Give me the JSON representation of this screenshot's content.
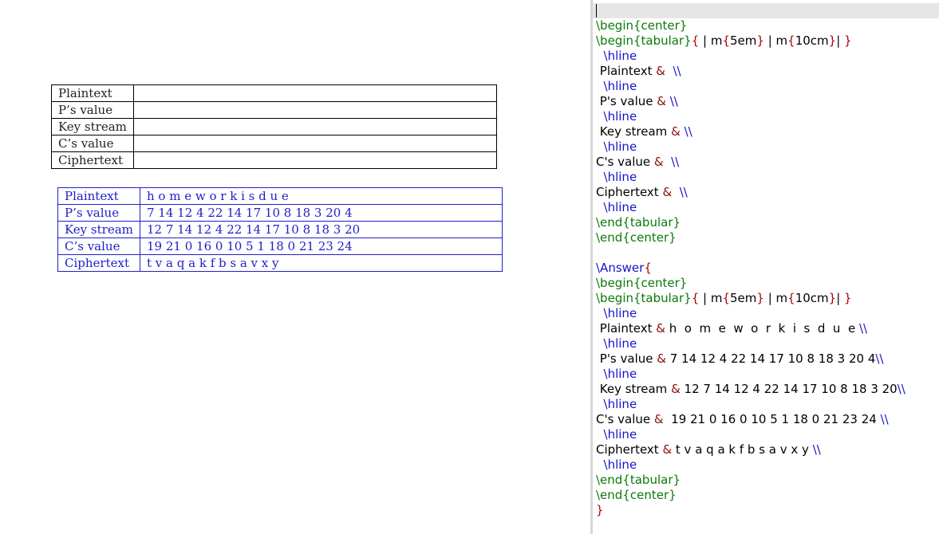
{
  "preview": {
    "question_table": {
      "rows": [
        {
          "label": "Plaintext",
          "value": ""
        },
        {
          "label": "P’s value",
          "value": ""
        },
        {
          "label": "Key stream",
          "value": ""
        },
        {
          "label": "C’s value",
          "value": ""
        },
        {
          "label": "Ciphertext",
          "value": ""
        }
      ]
    },
    "answer_table": {
      "rows": [
        {
          "label": "Plaintext",
          "value": "h o m e w o r k i s d u e"
        },
        {
          "label": "P’s value",
          "value": "7 14 12 4 22 14 17 10 8 18 3 20 4"
        },
        {
          "label": "Key stream",
          "value": "12 7 14 12 4 22 14 17 10 8 18 3 20"
        },
        {
          "label": "C’s value",
          "value": "19 21 0 16 0 10 5 1 18 0 21 23 24"
        },
        {
          "label": "Ciphertext",
          "value": "t v a q a k f b s a v x y"
        }
      ]
    }
  },
  "editor": {
    "lines": [
      [
        {
          "t": "\\begin{center}",
          "k": "env"
        }
      ],
      [
        {
          "t": "\\begin{tabular}",
          "k": "env"
        },
        {
          "t": "{",
          "k": "brace"
        },
        {
          "t": " | m",
          "k": "txt"
        },
        {
          "t": "{",
          "k": "brace"
        },
        {
          "t": "5em",
          "k": "txt"
        },
        {
          "t": "}",
          "k": "brace"
        },
        {
          "t": " | m",
          "k": "txt"
        },
        {
          "t": "{",
          "k": "brace"
        },
        {
          "t": "10cm",
          "k": "txt"
        },
        {
          "t": "}",
          "k": "brace"
        },
        {
          "t": "| ",
          "k": "txt"
        },
        {
          "t": "}",
          "k": "brace"
        }
      ],
      [
        {
          "t": "  \\hline",
          "k": "cmd"
        }
      ],
      [
        {
          "t": " Plaintext ",
          "k": "txt"
        },
        {
          "t": "&",
          "k": "amp"
        },
        {
          "t": "  ",
          "k": "txt"
        },
        {
          "t": "\\\\",
          "k": "cmd"
        }
      ],
      [
        {
          "t": "  \\hline",
          "k": "cmd"
        }
      ],
      [
        {
          "t": " P's value ",
          "k": "txt"
        },
        {
          "t": "&",
          "k": "amp"
        },
        {
          "t": " ",
          "k": "txt"
        },
        {
          "t": "\\\\",
          "k": "cmd"
        }
      ],
      [
        {
          "t": "  \\hline",
          "k": "cmd"
        }
      ],
      [
        {
          "t": " Key stream ",
          "k": "txt"
        },
        {
          "t": "&",
          "k": "amp"
        },
        {
          "t": " ",
          "k": "txt"
        },
        {
          "t": "\\\\",
          "k": "cmd"
        }
      ],
      [
        {
          "t": "  \\hline",
          "k": "cmd"
        }
      ],
      [
        {
          "t": "C's value ",
          "k": "txt"
        },
        {
          "t": "&",
          "k": "amp"
        },
        {
          "t": "  ",
          "k": "txt"
        },
        {
          "t": "\\\\",
          "k": "cmd"
        }
      ],
      [
        {
          "t": "  \\hline",
          "k": "cmd"
        }
      ],
      [
        {
          "t": "Ciphertext ",
          "k": "txt"
        },
        {
          "t": "&",
          "k": "amp"
        },
        {
          "t": "  ",
          "k": "txt"
        },
        {
          "t": "\\\\",
          "k": "cmd"
        }
      ],
      [
        {
          "t": "  \\hline",
          "k": "cmd"
        }
      ],
      [
        {
          "t": "\\end{tabular}",
          "k": "env"
        }
      ],
      [
        {
          "t": "\\end{center}",
          "k": "env"
        }
      ],
      [],
      [
        {
          "t": "\\Answer",
          "k": "cmd"
        },
        {
          "t": "{",
          "k": "brace"
        }
      ],
      [
        {
          "t": "\\begin{center}",
          "k": "env"
        }
      ],
      [
        {
          "t": "\\begin{tabular}",
          "k": "env"
        },
        {
          "t": "{",
          "k": "brace"
        },
        {
          "t": " | m",
          "k": "txt"
        },
        {
          "t": "{",
          "k": "brace"
        },
        {
          "t": "5em",
          "k": "txt"
        },
        {
          "t": "}",
          "k": "brace"
        },
        {
          "t": " | m",
          "k": "txt"
        },
        {
          "t": "{",
          "k": "brace"
        },
        {
          "t": "10cm",
          "k": "txt"
        },
        {
          "t": "}",
          "k": "brace"
        },
        {
          "t": "| ",
          "k": "txt"
        },
        {
          "t": "}",
          "k": "brace"
        }
      ],
      [
        {
          "t": "  \\hline",
          "k": "cmd"
        }
      ],
      [
        {
          "t": " Plaintext ",
          "k": "txt"
        },
        {
          "t": "&",
          "k": "amp"
        },
        {
          "t": " h  o  m  e  w  o  r  k  i  s  d  u  e ",
          "k": "txt"
        },
        {
          "t": "\\\\",
          "k": "cmd"
        }
      ],
      [
        {
          "t": "  \\hline",
          "k": "cmd"
        }
      ],
      [
        {
          "t": " P's value ",
          "k": "txt"
        },
        {
          "t": "&",
          "k": "amp"
        },
        {
          "t": " 7 14 12 4 22 14 17 10 8 18 3 20 4",
          "k": "txt"
        },
        {
          "t": "\\\\",
          "k": "cmd"
        }
      ],
      [
        {
          "t": "  \\hline",
          "k": "cmd"
        }
      ],
      [
        {
          "t": " Key stream ",
          "k": "txt"
        },
        {
          "t": "&",
          "k": "amp"
        },
        {
          "t": " 12 7 14 12 4 22 14 17 10 8 18 3 20",
          "k": "txt"
        },
        {
          "t": "\\\\",
          "k": "cmd"
        }
      ],
      [
        {
          "t": "  \\hline",
          "k": "cmd"
        }
      ],
      [
        {
          "t": "C's value ",
          "k": "txt"
        },
        {
          "t": "&",
          "k": "amp"
        },
        {
          "t": "  19 21 0 16 0 10 5 1 18 0 21 23 24 ",
          "k": "txt"
        },
        {
          "t": "\\\\",
          "k": "cmd"
        }
      ],
      [
        {
          "t": "  \\hline",
          "k": "cmd"
        }
      ],
      [
        {
          "t": "Ciphertext ",
          "k": "txt"
        },
        {
          "t": "&",
          "k": "amp"
        },
        {
          "t": " t v a q a k f b s a v x y ",
          "k": "txt"
        },
        {
          "t": "\\\\",
          "k": "cmd"
        }
      ],
      [
        {
          "t": "  \\hline",
          "k": "cmd"
        }
      ],
      [
        {
          "t": "\\end{tabular}",
          "k": "env"
        }
      ],
      [
        {
          "t": "\\end{center}",
          "k": "env"
        }
      ],
      [
        {
          "t": "}",
          "k": "brace"
        }
      ]
    ]
  }
}
